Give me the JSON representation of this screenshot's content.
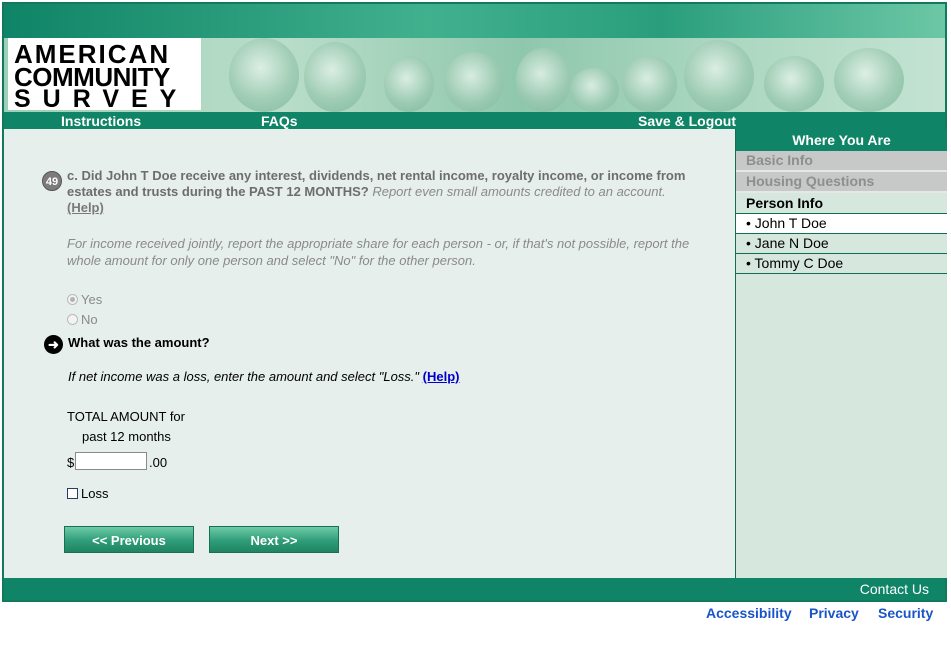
{
  "logo": {
    "line1": "AMERICAN",
    "line2": "COMMUNITY",
    "line3": "SURVEY"
  },
  "nav": {
    "instructions": "Instructions",
    "faqs": "FAQs",
    "save_logout": "Save & Logout"
  },
  "sidebar": {
    "heading": "Where You Are",
    "sections": [
      {
        "label": "Basic Info",
        "state": "disabled"
      },
      {
        "label": "Housing Questions",
        "state": "disabled"
      }
    ],
    "person_info": "Person Info",
    "persons": [
      {
        "label": "• John T Doe",
        "active": true
      },
      {
        "label": "• Jane N Doe",
        "active": false
      },
      {
        "label": "• Tommy C Doe",
        "active": false
      }
    ]
  },
  "question": {
    "number": "49",
    "text_bold": "c. Did John T Doe receive any interest, dividends, net rental income, royalty income, or income from estates and trusts during the PAST 12 MONTHS?",
    "text_italic": "Report even small amounts credited to an account.",
    "help_label": "(Help)",
    "joint_note": "For income received jointly, report the appropriate share for each person - or, if that's not possible, report the whole amount for only one person and select \"No\" for the other person.",
    "options": [
      {
        "label": "Yes",
        "selected": true
      },
      {
        "label": "No",
        "selected": false
      }
    ]
  },
  "amount": {
    "question": "What was the amount?",
    "loss_note": "If net income was a loss, enter the amount and select \"Loss.\"",
    "help_label": "(Help)",
    "total_label_line1": "TOTAL AMOUNT for",
    "total_label_line2": "past 12 months",
    "currency_symbol": "$",
    "value": "",
    "cents": ".00",
    "loss_label": "Loss",
    "loss_checked": false
  },
  "buttons": {
    "previous": "<<   Previous",
    "next": "Next   >>"
  },
  "footer": {
    "contact": "Contact Us"
  },
  "bottom_links": {
    "accessibility": "Accessibility",
    "privacy": "Privacy",
    "security": "Security"
  },
  "colors": {
    "primary_green": "#0f8466",
    "link_blue": "#1a55c8",
    "content_bg": "#e6efeb",
    "sidebar_bg": "#d6e7de"
  }
}
